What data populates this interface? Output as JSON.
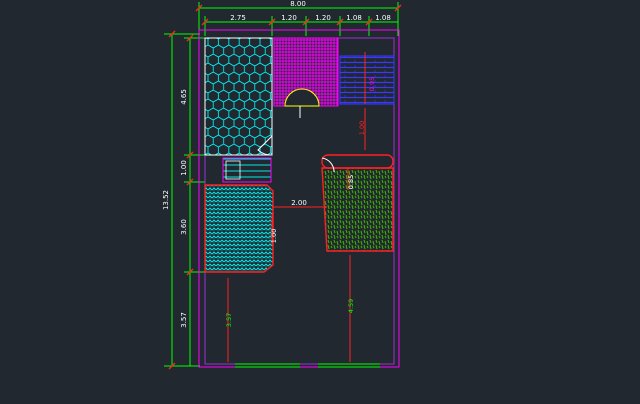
{
  "canvas": {
    "background": "#212830"
  },
  "colors": {
    "green": "#00ff00",
    "white": "#ffffff",
    "red": "#ff2020",
    "magenta": "#ff00ff",
    "purple": "#9b2fd6",
    "cyan": "#00ffff",
    "blue": "#3838ff",
    "yellow": "#ffff00",
    "darkgreen": "#3cb000"
  },
  "dimensions": {
    "overall_width": "8.00",
    "seg_1": "2.75",
    "seg_2": "1.20",
    "seg_3": "1.20",
    "seg_4": "1.08",
    "seg_5": "1.08",
    "overall_height": "13.52",
    "left_1": "4.65",
    "left_2": "1.00",
    "left_3": "3.60",
    "left_4": "3.57",
    "inner_v1": "0.95",
    "inner_v2": "1.00",
    "inner_v3": "0.85",
    "inner_v4": "1.00",
    "inner_h": "2.00",
    "inner_v5": "3.57",
    "inner_v6": "4.59"
  }
}
